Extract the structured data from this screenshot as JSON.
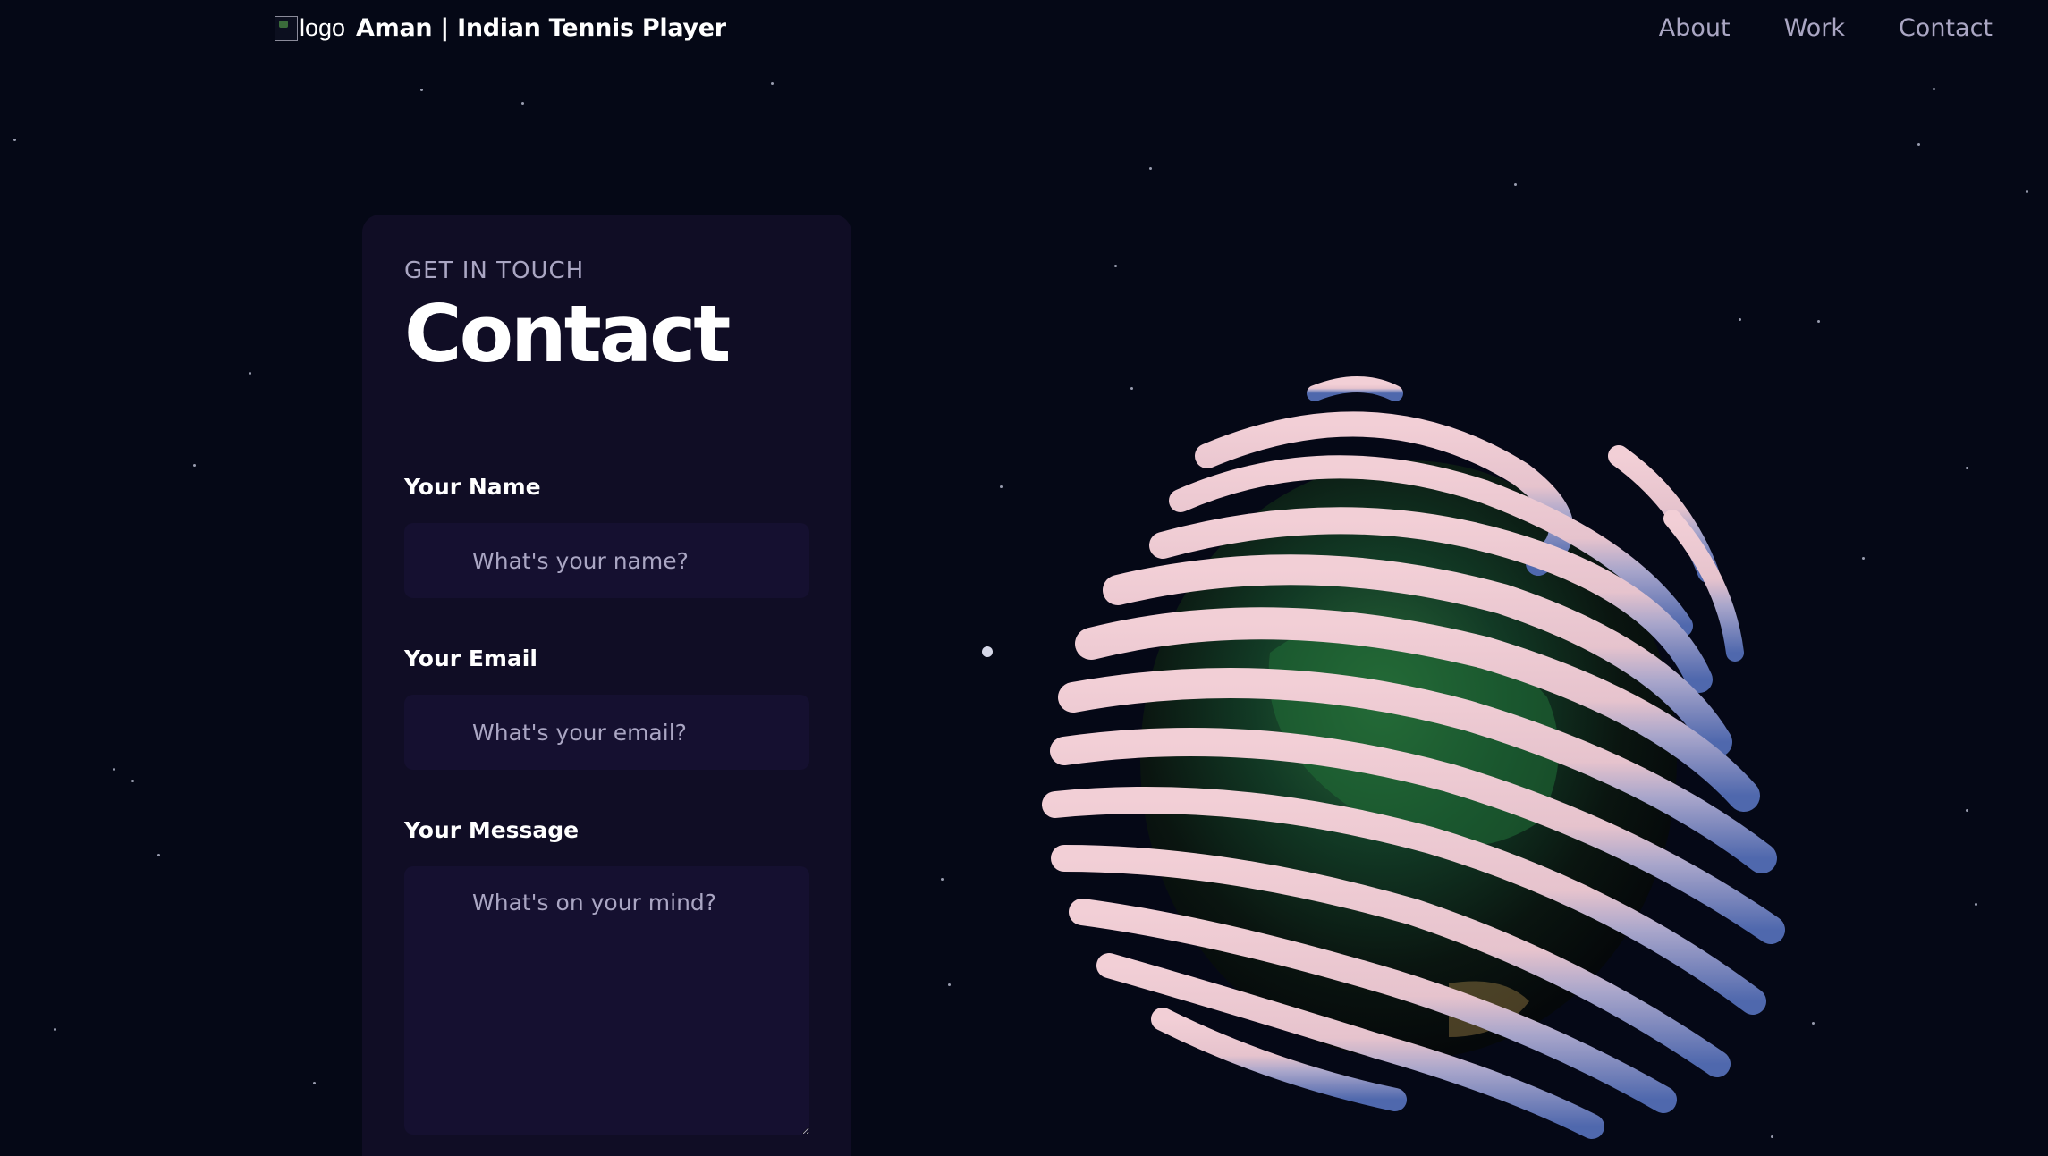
{
  "navbar": {
    "logo_alt": "logo",
    "brand": "Aman | Indian Tennis Player",
    "links": [
      "About",
      "Work",
      "Contact"
    ]
  },
  "contact": {
    "eyebrow": "GET IN TOUCH",
    "title": "Contact",
    "fields": {
      "name": {
        "label": "Your Name",
        "placeholder": "What's your name?"
      },
      "email": {
        "label": "Your Email",
        "placeholder": "What's your email?"
      },
      "message": {
        "label": "Your Message",
        "placeholder": "What's on your mind?"
      }
    }
  },
  "colors": {
    "background": "#050816",
    "card": "#100d25",
    "input": "#151030",
    "secondary_text": "#aaa6c3",
    "globe_ring_pink": "#e9c6cf",
    "globe_ring_blue": "#5f76b6"
  },
  "scene": {
    "globe": "earth-globe-with-swirl-rings"
  }
}
